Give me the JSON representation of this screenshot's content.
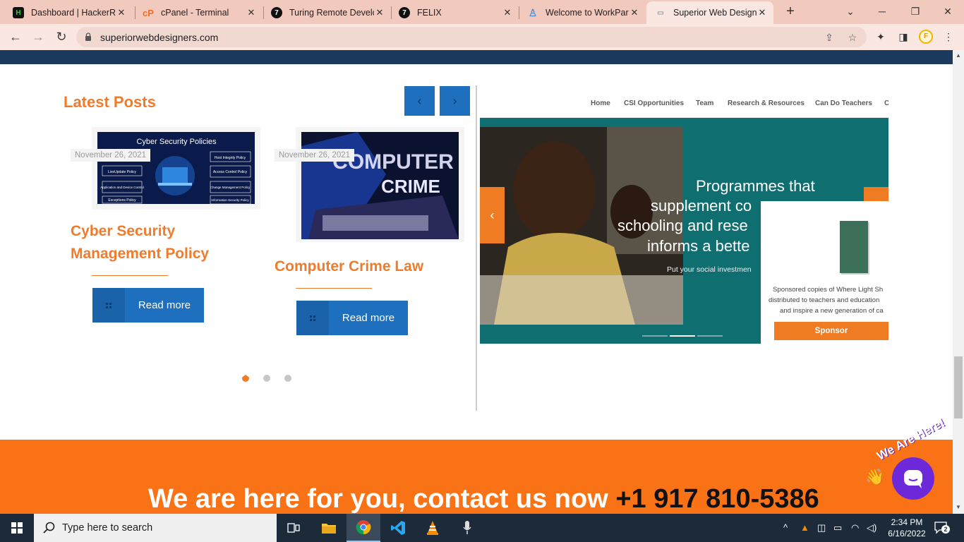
{
  "browser": {
    "tabs": [
      {
        "title": "Dashboard | HackerRa",
        "icon": "hackerrank-icon"
      },
      {
        "title": "cPanel - Terminal",
        "icon": "cpanel-icon"
      },
      {
        "title": "Turing Remote Develo",
        "icon": "turing-icon"
      },
      {
        "title": "FELIX",
        "icon": "turing-icon"
      },
      {
        "title": "Welcome to WorkPar",
        "icon": "workpark-icon"
      },
      {
        "title": "Superior Web Designe",
        "icon": "swd-icon",
        "active": true
      }
    ],
    "new_tab": "+",
    "url": "superiorwebdesigners.com",
    "profile_initial": "F"
  },
  "page": {
    "latest_posts_title": "Latest Posts",
    "prev_arrow": "‹",
    "next_arrow": "›",
    "posts": [
      {
        "date": "November 26, 2021",
        "image_heading": "Cyber Security Policies",
        "image_labels": [
          "Host Integrity Policy",
          "LiveUpdate Policy",
          "Access Control Policy",
          "Application and Device Control",
          "Change Management Policy",
          "Exceptions Policy",
          "Information Security Policy"
        ],
        "title_line1": "Cyber Security",
        "title_line2": "Management Policy",
        "button": "Read more"
      },
      {
        "date": "November 26, 2021",
        "image_heading_1": "COMPUTER",
        "image_heading_2": "CRIME",
        "title_line1": "Computer Crime Law",
        "button": "Read more"
      }
    ],
    "carousel_dots": 3,
    "carousel_active": 0
  },
  "embed": {
    "nav": [
      "Home",
      "CSI Opportunities",
      "Team",
      "Research & Resources",
      "Can Do Teachers",
      "C"
    ],
    "hero_lines": [
      "Programmes that",
      "supplement co",
      "schooling and rese",
      "informs a bette"
    ],
    "hero_sub": "Put your social investmen",
    "prev": "‹",
    "next": "›",
    "popup_lines": [
      "Sponsored copies of Where Light Sh",
      "distributed to teachers and education",
      "and inspire a new generation of ca"
    ],
    "sponsor_button": "Sponsor"
  },
  "footer": {
    "contact_text": "We are here for you, contact us now ",
    "phone": "+1 917 810-5386",
    "chat_badge": "We Are Here!",
    "wave_emoji": "👋"
  },
  "taskbar": {
    "search_placeholder": "Type here to search",
    "time": "2:34 PM",
    "date": "6/16/2022",
    "notifications": "2"
  }
}
